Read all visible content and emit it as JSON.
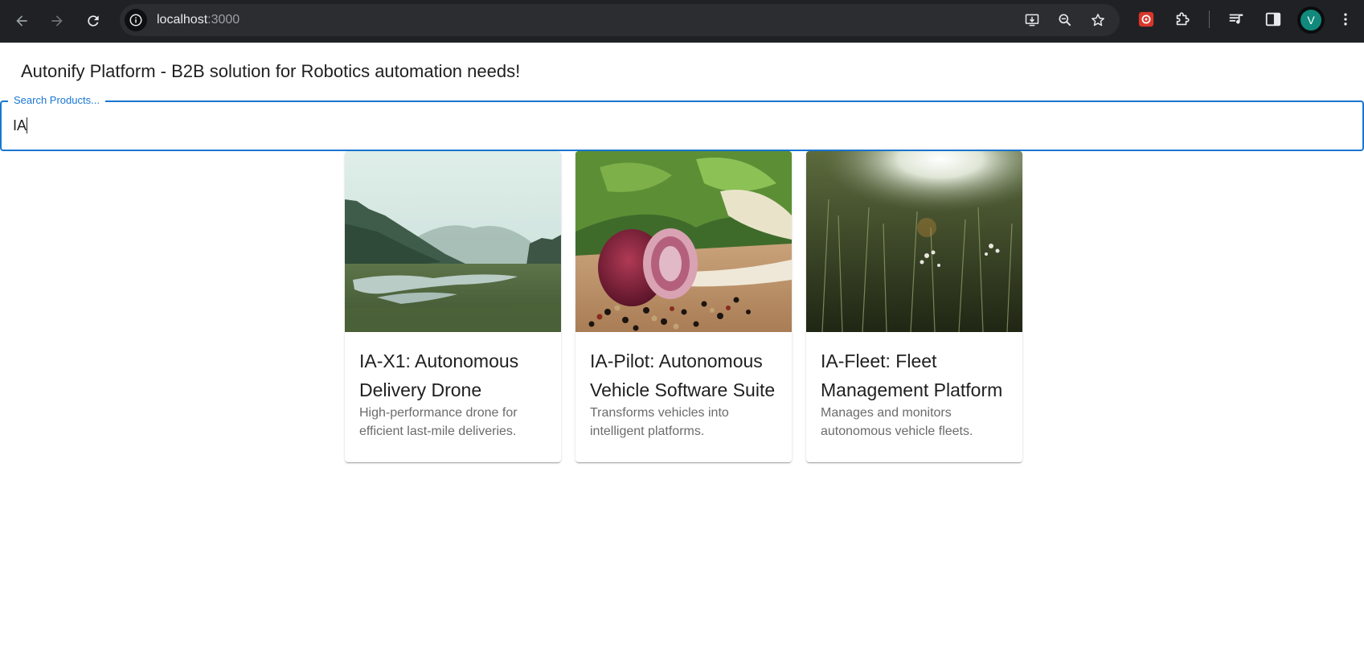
{
  "browser": {
    "url_host": "localhost",
    "url_port": ":3000",
    "profile_initial": "V",
    "icons": {
      "back": "arrow-left-icon",
      "forward": "arrow-right-icon",
      "reload": "reload-icon",
      "site_info": "info-icon",
      "install": "install-app-icon",
      "zoom": "zoom-out-icon",
      "bookmark": "star-icon",
      "extension_1": "extension-red-icon",
      "extensions": "puzzle-icon",
      "media": "media-queue-icon",
      "side_panel": "side-panel-icon",
      "menu": "kebab-menu-icon"
    }
  },
  "page": {
    "title": "Autonify Platform - B2B solution for Robotics automation needs!"
  },
  "search": {
    "label": "Search Products...",
    "value": "IA"
  },
  "products": [
    {
      "title": "IA-X1: Autonomous Delivery Drone",
      "description": "High-performance drone for efficient last-mile deliveries."
    },
    {
      "title": "IA-Pilot: Autonomous Vehicle Software Suite",
      "description": "Transforms vehicles into intelligent platforms."
    },
    {
      "title": "IA-Fleet: Fleet Management Platform",
      "description": "Manages and monitors autonomous vehicle fleets."
    }
  ],
  "colors": {
    "accent": "#1976d2",
    "chrome_bg": "#1f2124",
    "avatar": "#11897c"
  }
}
